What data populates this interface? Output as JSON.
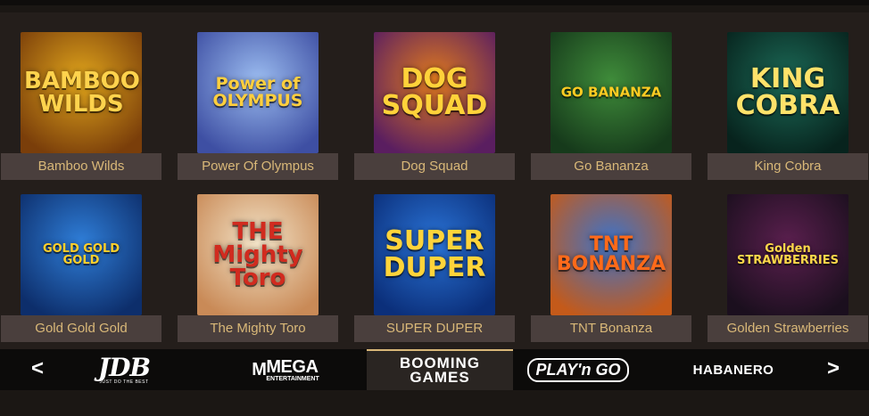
{
  "games": [
    {
      "name": "Bamboo Wilds",
      "art_lines": [
        "BAMBOO",
        "WILDS"
      ],
      "colors": [
        "#e0a51c",
        "#7a3e0a"
      ],
      "text_color": "#ffd34d"
    },
    {
      "name": "Power Of Olympus",
      "art_lines": [
        "Power of",
        "OLYMPUS"
      ],
      "colors": [
        "#9bbcf0",
        "#3e4fa3"
      ],
      "text_color": "#ffcf3e"
    },
    {
      "name": "Dog Squad",
      "art_lines": [
        "DOG",
        "SQUAD"
      ],
      "colors": [
        "#e07a1e",
        "#5a1e60"
      ],
      "text_color": "#ffd23a"
    },
    {
      "name": "Go Bananza",
      "art_lines": [
        "GO BANANZA"
      ],
      "colors": [
        "#3f8c3a",
        "#163a1b"
      ],
      "text_color": "#ffcc22"
    },
    {
      "name": "King Cobra",
      "art_lines": [
        "KING",
        "COBRA"
      ],
      "colors": [
        "#1c6a57",
        "#07231d"
      ],
      "text_color": "#ffe26a"
    },
    {
      "name": "Gold Gold Gold",
      "art_lines": [
        "GOLD GOLD GOLD"
      ],
      "colors": [
        "#2f7ed8",
        "#0d2e6b"
      ],
      "text_color": "#ffd02a"
    },
    {
      "name": "The Mighty Toro",
      "art_lines": [
        "THE",
        "Mighty",
        "Toro"
      ],
      "colors": [
        "#f3e4c8",
        "#c98a57"
      ],
      "text_color": "#d12b1f"
    },
    {
      "name": "SUPER DUPER",
      "art_lines": [
        "SUPER",
        "DUPER"
      ],
      "colors": [
        "#2a73d6",
        "#0b2f7a"
      ],
      "text_color": "#ffd43a"
    },
    {
      "name": "TNT Bonanza",
      "art_lines": [
        "TNT",
        "BONANZA"
      ],
      "colors": [
        "#3d73c9",
        "#c45a1a"
      ],
      "text_color": "#ff6a1a"
    },
    {
      "name": "Golden Strawberries",
      "art_lines": [
        "Golden",
        "STRAWBERRIES"
      ],
      "colors": [
        "#5a1f4e",
        "#1b0f1e"
      ],
      "text_color": "#ffd84a"
    }
  ],
  "providers": {
    "prev_label": "<",
    "next_label": ">",
    "items": [
      {
        "name": "JDB",
        "sub": "JUST DO THE BEST",
        "active": false
      },
      {
        "name": "MEGA",
        "sub": "ENTERTAINMENT",
        "active": false
      },
      {
        "name": "BOOMING",
        "sub": "GAMES",
        "active": true
      },
      {
        "name": "PLAY'n GO",
        "sub": "",
        "active": false
      },
      {
        "name": "HABANERO",
        "sub": "",
        "active": false
      }
    ]
  }
}
